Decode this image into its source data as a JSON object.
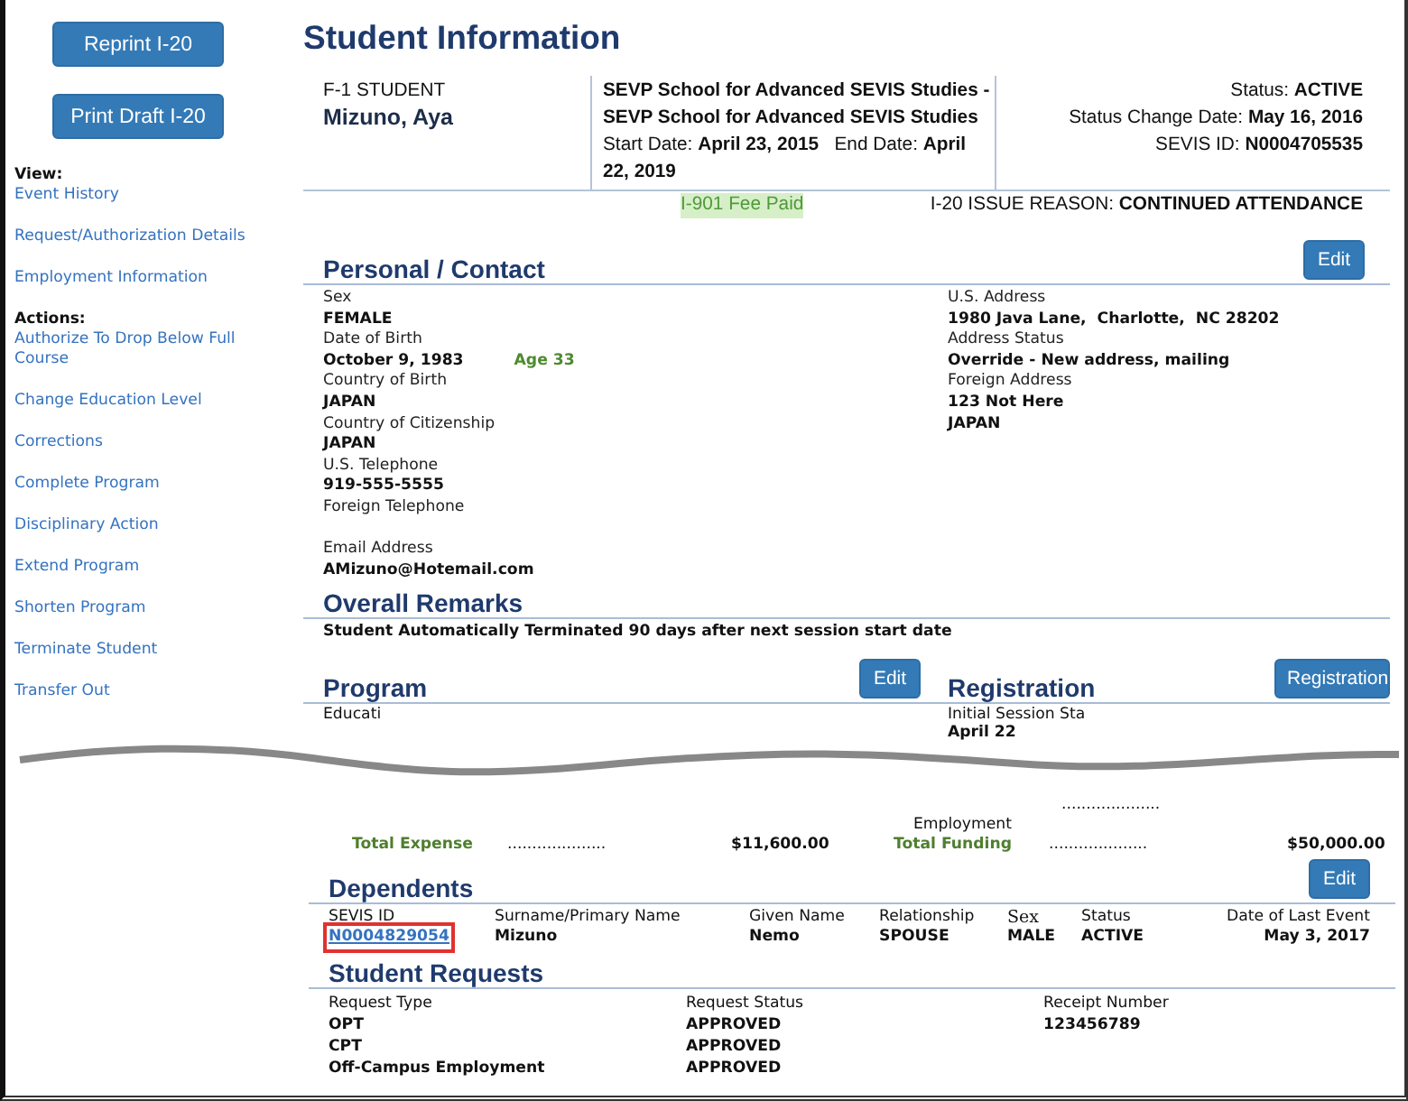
{
  "sidebar": {
    "buttons": [
      "Reprint I-20",
      "Print Draft I-20"
    ],
    "groups": [
      {
        "heading": "View:",
        "links": [
          "Event History",
          "Request/Authorization Details",
          "Employment Information"
        ]
      },
      {
        "heading": "Actions:",
        "links": [
          "Authorize To Drop Below Full Course",
          "Change Education Level",
          "Corrections",
          "Complete Program",
          "Disciplinary Action",
          "Extend Program",
          "Shorten Program",
          "Terminate Student",
          "Transfer Out"
        ]
      }
    ]
  },
  "title": "Student Information",
  "header": {
    "category": "F-1 STUDENT",
    "name": "Mizuno, Aya",
    "school_lines": [
      "SEVP School for Advanced SEVIS Studies -",
      "SEVP School for Advanced SEVIS Studies"
    ],
    "dates": [
      {
        "label": "Start Date:",
        "value": "April 23, 2015"
      },
      {
        "label": "End Date:",
        "value": "April 22, 2019"
      }
    ],
    "status": [
      {
        "label": "Status:",
        "value": "ACTIVE"
      },
      {
        "label": "Status Change Date:",
        "value": "May 16, 2016"
      },
      {
        "label": "SEVIS ID:",
        "value": "N0004705535"
      }
    ]
  },
  "fee_status": "I-901 Fee Paid",
  "issue_reason": {
    "label": "I-20 ISSUE REASON:",
    "value": "CONTINUED ATTENDANCE"
  },
  "personal": {
    "title": "Personal / Contact",
    "button": "Edit",
    "left": [
      {
        "label": "Sex",
        "value": "FEMALE"
      },
      {
        "label": "Date of Birth",
        "value": "October 9, 1983",
        "note": "Age 33"
      },
      {
        "label": "Country of Birth",
        "value": "JAPAN"
      },
      {
        "label": "Country of Citizenship",
        "value": "JAPAN"
      },
      {
        "label": "U.S. Telephone",
        "value": "919-555-5555"
      },
      {
        "label": "Foreign Telephone"
      },
      {
        "label": "Email Address",
        "value": "AMizuno@Hotemail.com"
      }
    ],
    "right": [
      {
        "label": "U.S. Address",
        "value": "1980 Java Lane,  Charlotte,  NC 28202"
      },
      {
        "label": "Address Status",
        "value": "Override - New address, mailing"
      },
      {
        "label": "Foreign Address",
        "value": "123 Not Here",
        "value2": "JAPAN"
      }
    ]
  },
  "remarks": {
    "title": "Overall Remarks",
    "text": "Student Automatically Terminated 90 days after next session start date"
  },
  "program": {
    "title": "Program",
    "button": "Edit",
    "label": "Educati"
  },
  "registration": {
    "title": "Registration",
    "button": "Registration",
    "label": "Initial Session Sta",
    "value": "April 22"
  },
  "finance": {
    "funding_above": {
      "label": "Employment",
      "dots": "...................."
    },
    "expense": {
      "label": "Total Expense",
      "dots": "....................",
      "amount": "$11,600.00"
    },
    "funding": {
      "label": "Total Funding",
      "dots": "....................",
      "amount": "$50,000.00"
    }
  },
  "dependents": {
    "title": "Dependents",
    "button": "Edit",
    "columns": [
      "SEVIS ID",
      "Surname/Primary Name",
      "Given Name",
      "Relationship",
      "Sex",
      "Status",
      "Date of Last Event"
    ],
    "rows": [
      {
        "highlighted": true,
        "cells": [
          "N0004829054",
          "Mizuno",
          "Nemo",
          "SPOUSE",
          "MALE",
          "ACTIVE",
          "May 3, 2017"
        ]
      }
    ]
  },
  "requests": {
    "title": "Student Requests",
    "columns": [
      "Request Type",
      "Request Status",
      "Receipt Number"
    ],
    "rows": [
      [
        "OPT",
        "APPROVED",
        "123456789"
      ],
      [
        "CPT",
        "APPROVED"
      ],
      [
        "Off-Campus Employment",
        "APPROVED"
      ]
    ]
  }
}
